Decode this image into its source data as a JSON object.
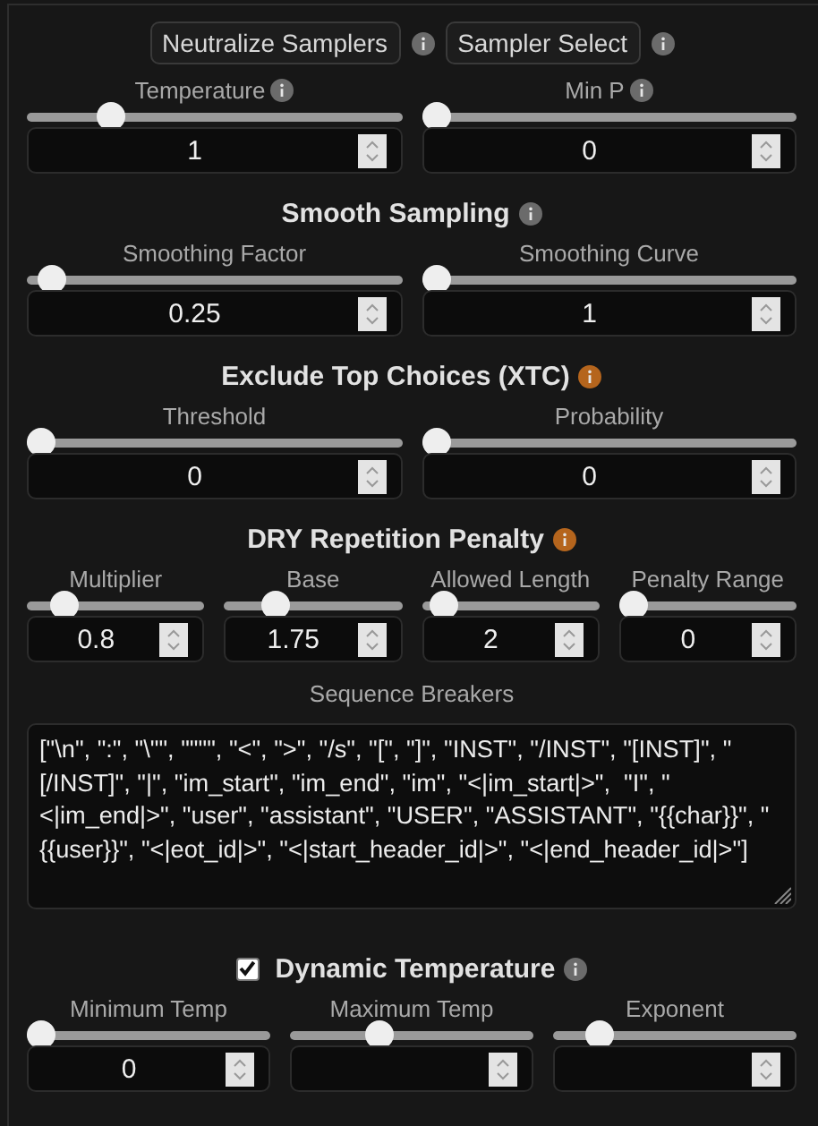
{
  "buttons": [
    {
      "label": "Neutralize Samplers",
      "info": {
        "color": "#6b6b6b"
      }
    },
    {
      "label": "Sampler Select",
      "info": {
        "color": "#6b6b6b"
      }
    }
  ],
  "sections": [
    {
      "params": [
        {
          "label": "Temperature",
          "info": {
            "color": "#6b6b6b"
          },
          "level": 0.2,
          "value": "1"
        },
        {
          "label": "Min P",
          "info": {
            "color": "#6b6b6b"
          },
          "level": 0,
          "value": "0"
        }
      ]
    },
    {
      "title": "Smooth Sampling",
      "info": {
        "color": "#6b6b6b"
      },
      "params": [
        {
          "label": "Smoothing Factor",
          "level": 0.03,
          "value": "0.25"
        },
        {
          "label": "Smoothing Curve",
          "level": 0,
          "value": "1"
        }
      ]
    },
    {
      "title": "Exclude Top Choices (XTC)",
      "info": {
        "color": "#b5651d"
      },
      "params": [
        {
          "label": "Threshold",
          "level": 0,
          "value": "0"
        },
        {
          "label": "Probability",
          "level": 0,
          "value": "0"
        }
      ]
    },
    {
      "title": "DRY Repetition Penalty",
      "info": {
        "color": "#b5651d"
      },
      "params": [
        {
          "label": "Multiplier",
          "level": 0.16,
          "value": "0.8"
        },
        {
          "label": "Base",
          "level": 0.25,
          "value": "1.75"
        },
        {
          "label": "Allowed Length",
          "level": 0.06,
          "value": "2"
        },
        {
          "label": "Penalty Range",
          "level": 0,
          "value": "0"
        }
      ],
      "text_field": {
        "label": "Sequence Breakers",
        "value": "[\"\\n\", \":\", \"\\\"\", \"\"\"\", \"<\", \">\", \"/s\", \"[\", \"]\", \"INST\", \"/INST\", \"[INST]\", \"[/INST]\", \"|\", \"im_start\", \"im_end\", \"im\", \"<|im_start|>\",  \"I\", \"<|im_end|>\", \"user\", \"assistant\", \"USER\", \"ASSISTANT\", \"{{char}}\", \"{{user}}\", \"<|eot_id|>\", \"<|start_header_id|>\", \"<|end_header_id|>\"]"
      }
    },
    {
      "title": "Dynamic Temperature",
      "checked": true,
      "info": {
        "color": "#6b6b6b"
      },
      "params": [
        {
          "label": "Minimum Temp",
          "level": 0,
          "value": "0"
        },
        {
          "label": "Maximum Temp",
          "level": 0.35
        },
        {
          "label": "Exponent",
          "level": 0.15
        }
      ]
    }
  ]
}
